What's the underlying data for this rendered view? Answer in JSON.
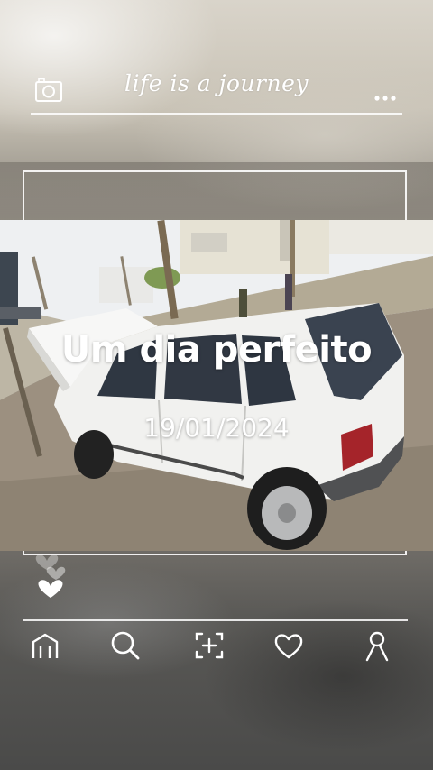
{
  "header": {
    "brand": "life is a journey",
    "left_icon": "camera-icon",
    "right_icon": "more-horizontal-icon"
  },
  "post": {
    "title": "Um dia perfeito",
    "date": "19/01/2024",
    "image_subject": "white-hatchback-car-photo"
  },
  "reactions": {
    "icon": "hearts-icon"
  },
  "nav": {
    "items": [
      {
        "icon": "home-icon"
      },
      {
        "icon": "search-icon"
      },
      {
        "icon": "add-photo-icon"
      },
      {
        "icon": "heart-icon"
      },
      {
        "icon": "profile-icon"
      }
    ]
  },
  "colors": {
    "text": "#ffffff",
    "divider": "#ffffff",
    "background": "#6e6b66"
  }
}
